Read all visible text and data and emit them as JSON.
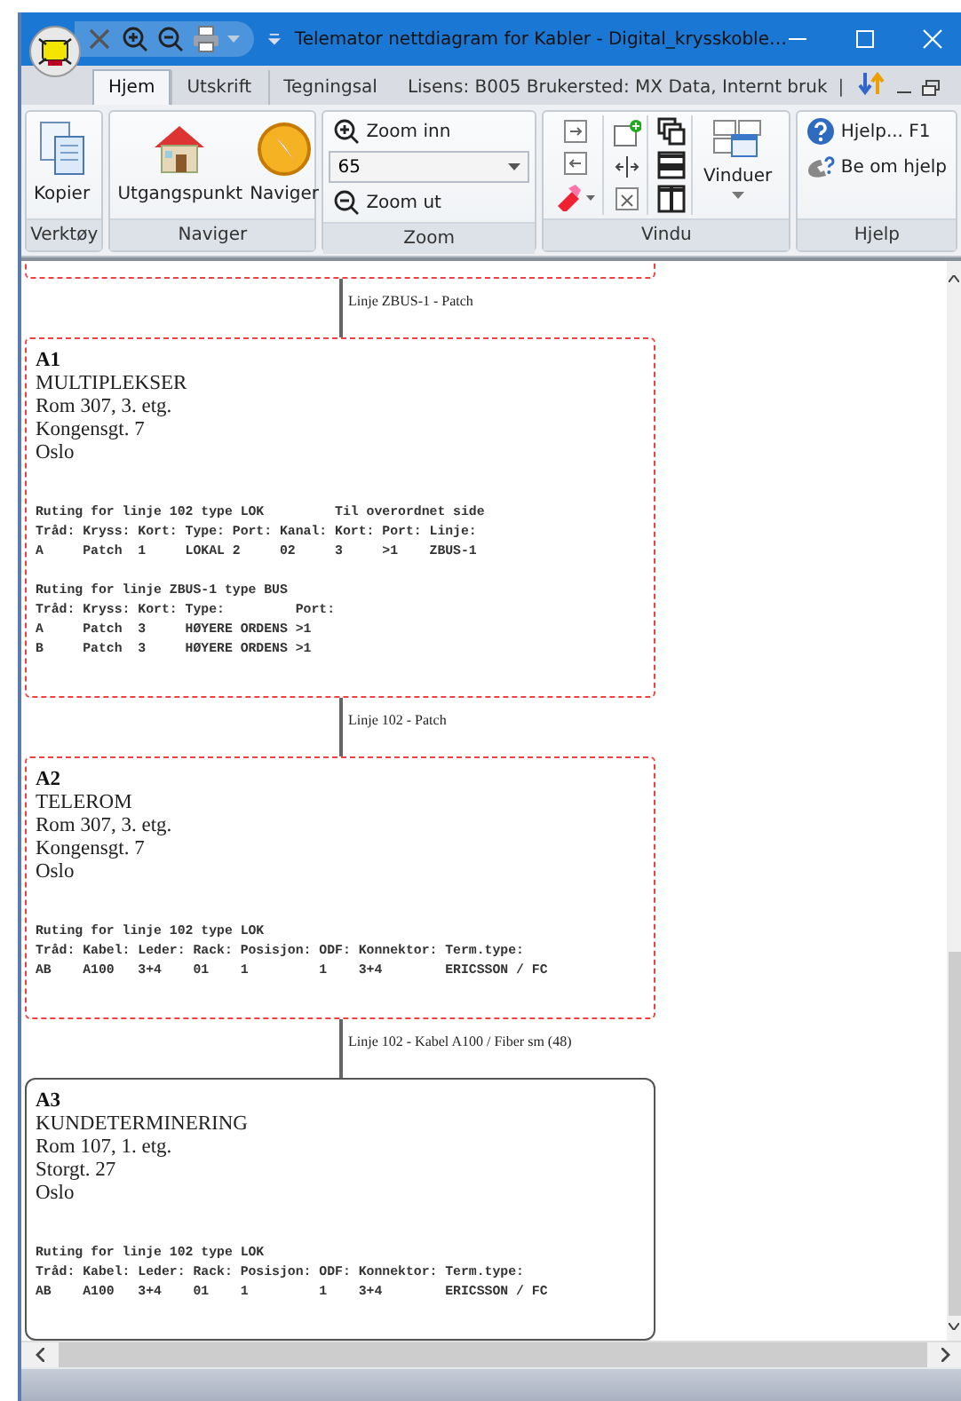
{
  "window": {
    "title": "Telemator nettdiagram for Kabler - Digital_krysskoble…"
  },
  "quick_access": [
    {
      "kind": "close"
    },
    {
      "kind": "zoom-in"
    },
    {
      "kind": "zoom-out"
    },
    {
      "kind": "print"
    }
  ],
  "tabs": [
    {
      "label": "Hjem",
      "selected": true
    },
    {
      "label": "Utskrift",
      "selected": false
    },
    {
      "label": "Tegningsal",
      "selected": false
    }
  ],
  "license": "Lisens: B005 Brukersted: MX Data, Internt bruk",
  "separator": "|",
  "ribbon": {
    "groups": [
      {
        "label": "Verktøy",
        "kind": "copy",
        "items": [
          {
            "label": "Kopier"
          }
        ]
      },
      {
        "label": "Naviger",
        "kind": "nav",
        "items": [
          {
            "label": "Utgangspunkt"
          },
          {
            "label": "Naviger"
          }
        ]
      },
      {
        "label": "Zoom",
        "kind": "zoom",
        "items": [
          {
            "label": "Zoom inn"
          },
          {
            "label": "Zoom ut"
          }
        ],
        "value": "65"
      },
      {
        "label": "Vindu",
        "kind": "window",
        "items": [
          {
            "label": "Vinduer"
          }
        ]
      },
      {
        "label": "Hjelp",
        "kind": "help",
        "items": [
          {
            "label": "Hjelp... F1"
          },
          {
            "label": "Be om hjelp"
          }
        ]
      }
    ]
  },
  "diagram": [
    {
      "kind": "dashed",
      "clipped": true
    },
    {
      "kind": "link",
      "label": "Linje ZBUS-1 - Patch"
    },
    {
      "kind": "dashed",
      "clipped": false,
      "name": "A1",
      "lines": [
        "MULTIPLEKSER",
        "Rom 307, 3. etg.",
        "Kongensgt. 7",
        "Oslo"
      ],
      "routing": [
        [
          "Ruting for linje 102 type LOK         Til overordnet side",
          "Tråd: Kryss: Kort: Type: Port: Kanal: Kort: Port: Linje:",
          "A     Patch  1     LOKAL 2     02     3     >1    ZBUS-1"
        ],
        [
          "Ruting for linje ZBUS-1 type BUS",
          "Tråd: Kryss: Kort: Type:         Port:",
          "A     Patch  3     HØYERE ORDENS >1",
          "B     Patch  3     HØYERE ORDENS >1"
        ]
      ]
    },
    {
      "kind": "link",
      "label": "Linje 102 - Patch"
    },
    {
      "kind": "dashed",
      "clipped": false,
      "name": "A2",
      "lines": [
        "TELEROM",
        "Rom 307, 3. etg.",
        "Kongensgt. 7",
        "Oslo"
      ],
      "routing": [
        [
          "Ruting for linje 102 type LOK",
          "Tråd: Kabel: Leder: Rack: Posisjon: ODF: Konnektor: Term.type:",
          "AB    A100   3+4    01    1         1    3+4        ERICSSON / FC"
        ]
      ]
    },
    {
      "kind": "link",
      "label": "Linje 102 - Kabel A100 / Fiber sm (48)"
    },
    {
      "kind": "solid",
      "clipped": false,
      "name": "A3",
      "lines": [
        "KUNDETERMINERING",
        "Rom 107, 1. etg.",
        "Storgt. 27",
        "Oslo"
      ],
      "routing": [
        [
          "Ruting for linje 102 type LOK",
          "Tråd: Kabel: Leder: Rack: Posisjon: ODF: Konnektor: Term.type:",
          "AB    A100   3+4    01    1         1    3+4        ERICSSON / FC"
        ]
      ]
    }
  ]
}
